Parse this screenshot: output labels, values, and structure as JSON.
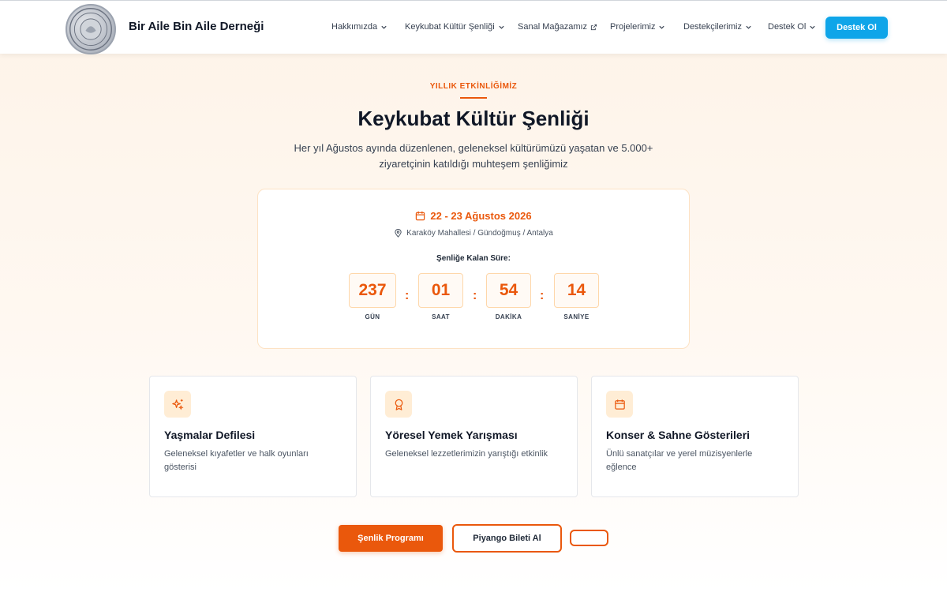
{
  "header": {
    "brand": "Bir Aile Bin Aile Derneği",
    "logo_icon": "seal-logo",
    "nav": [
      {
        "label": "Hakkımızda",
        "icon": "chevron-down-icon"
      },
      {
        "label": "Keykubat Kültür Şenliği",
        "icon": "chevron-down-icon"
      },
      {
        "label": "Sanal Mağazamız",
        "icon": "external-link-icon"
      },
      {
        "label": "Projelerimiz",
        "icon": "chevron-down-icon"
      },
      {
        "label": "Destekçilerimiz",
        "icon": "chevron-down-icon"
      },
      {
        "label": "Destek Ol",
        "icon": "chevron-down-icon"
      }
    ],
    "cta": "Destek Ol"
  },
  "hero": {
    "eyebrow": "YILLIK ETKİNLİĞİMİZ",
    "title": "Keykubat Kültür Şenliği",
    "subtitle_line1": "Her yıl Ağustos ayında düzenlenen, geleneksel kültürümüzü yaşatan ve 5.000+",
    "subtitle_line2": "ziyaretçinin katıldığı muhteşem şenliğimiz"
  },
  "countdown": {
    "date": "22 - 23 Ağustos 2026",
    "location": "Karaköy Mahallesi / Gündoğmuş / Antalya",
    "remaining_label": "Şenliğe Kalan Süre:",
    "units": [
      {
        "value": "237",
        "label": "GÜN"
      },
      {
        "value": "01",
        "label": "SAAT"
      },
      {
        "value": "54",
        "label": "DAKİKA"
      },
      {
        "value": "14",
        "label": "SANİYE"
      }
    ],
    "separator": ":"
  },
  "features": [
    {
      "icon": "sparkles-icon",
      "title": "Yaşmalar Defilesi",
      "desc": "Geleneksel kıyafetler ve halk oyunları gösterisi"
    },
    {
      "icon": "award-icon",
      "title": "Yöresel Yemek Yarışması",
      "desc": "Geleneksel lezzetlerimizin yarıştığı etkinlik"
    },
    {
      "icon": "calendar-icon",
      "title": "Konser & Sahne Gösterileri",
      "desc": "Ünlü sanatçılar ve yerel müzisyenlerle eğlence"
    }
  ],
  "actions": {
    "primary": "Şenlik Programı",
    "secondary": "Piyango Bileti Al",
    "tertiary": ""
  },
  "colors": {
    "accent": "#ea580c",
    "cta_blue": "#0ea5e9"
  }
}
